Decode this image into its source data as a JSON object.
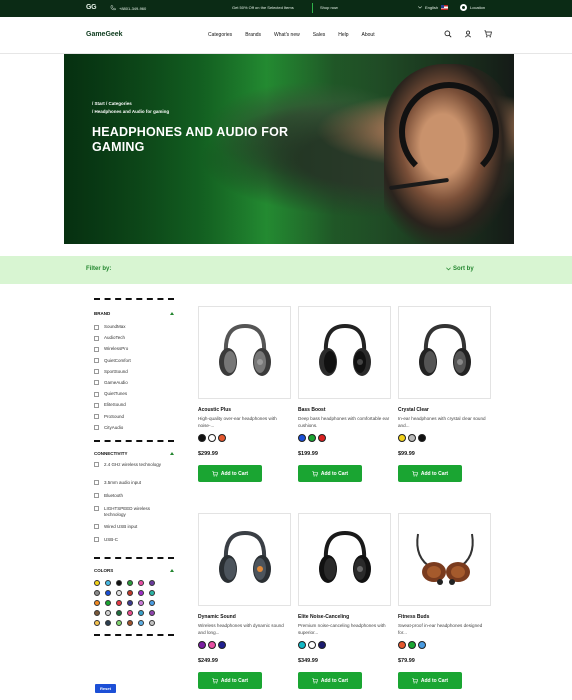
{
  "topbar": {
    "logo": "GG",
    "phone": "+8801-349-960",
    "promo": "Get 50% Off on the Selected Items",
    "shop_now": "Shop now",
    "language": "English",
    "location": "Location"
  },
  "nav": {
    "brand": "GameGeek",
    "menu": [
      "Categories",
      "Brands",
      "What's new",
      "Sales",
      "Help",
      "About"
    ]
  },
  "hero": {
    "breadcrumb_1": "/ Start / Categories",
    "breadcrumb_2": "/ Headphones and Audio for gaming",
    "title": "HEADPHONES AND AUDIO FOR GAMING"
  },
  "filterbar": {
    "filter_label": "Filter by:",
    "sort_label": "Sort by"
  },
  "sidebar": {
    "brand_title": "BRAND",
    "brands": [
      "SoundMax",
      "AudioTech",
      "WirelessPro",
      "QuietComfort",
      "SportSound",
      "GameAudio",
      "QuietTunes",
      "EliteSound",
      "ProSound",
      "CityAudio"
    ],
    "connectivity_title": "CONNECTIVITY",
    "connectivity": [
      "2.4 GHz wireless technology",
      "3.5mm audio input",
      "Bluetooth",
      "LIGHTSPEED wireless technology",
      "Wired USB input",
      "USB-C"
    ],
    "colors_title": "COLORS",
    "colors": [
      "#f2d21b",
      "#47b9e3",
      "#111111",
      "#2a9a3c",
      "#e64fa3",
      "#6a3b9c",
      "#8a8a8a",
      "#1a4fd6",
      "#e0e0e0",
      "#c0392b",
      "#9d2fc4",
      "#2bb3a4",
      "#f08a24",
      "#1aa532",
      "#e63946",
      "#3c3c8f",
      "#c97bd6",
      "#4a9be0",
      "#7b5a3a",
      "#d1d1d1",
      "#1f6f3f",
      "#e84b8a",
      "#3aa0c8",
      "#8e44ad",
      "#f2c14e",
      "#2c3e50",
      "#7fd36e",
      "#a0522d",
      "#5dade2",
      "#c0c0c0"
    ],
    "reset_label": "Reset"
  },
  "products": [
    {
      "name": "Acoustic Plus",
      "desc": "High-quality over-ear headphones with noise-...",
      "price": "$299.99",
      "colors": [
        "#111111",
        "#ffffff",
        "#e4572e"
      ],
      "cart": "Add to Cart"
    },
    {
      "name": "Bass Boost",
      "desc": "Deep bass headphones with comfortable ear cushions.",
      "price": "$199.99",
      "colors": [
        "#1a4fd6",
        "#1aa532",
        "#d92020"
      ],
      "cart": "Add to Cart"
    },
    {
      "name": "Crystal Clear",
      "desc": "In-ear headphones with crystal clear sound and...",
      "price": "$99.99",
      "colors": [
        "#f2d21b",
        "#b8b8b8",
        "#111111"
      ],
      "cart": "Add to Cart"
    },
    {
      "name": "Dynamic Sound",
      "desc": "Wireless headphones with dynamic sound and long...",
      "price": "$249.99",
      "colors": [
        "#7a1fa0",
        "#e64fa3",
        "#1f1f8f"
      ],
      "cart": "Add to Cart"
    },
    {
      "name": "Elite Noise-Canceling",
      "desc": "Premium noise-canceling headphones with superior...",
      "price": "$349.99",
      "colors": [
        "#12b7c4",
        "#ffffff",
        "#1a1a6e"
      ],
      "cart": "Add to Cart"
    },
    {
      "name": "Fitness Buds",
      "desc": "Sweat-proof in-ear headphones designed for...",
      "price": "$79.99",
      "colors": [
        "#e4572e",
        "#1aa532",
        "#4a9be0"
      ],
      "cart": "Add to Cart"
    }
  ]
}
